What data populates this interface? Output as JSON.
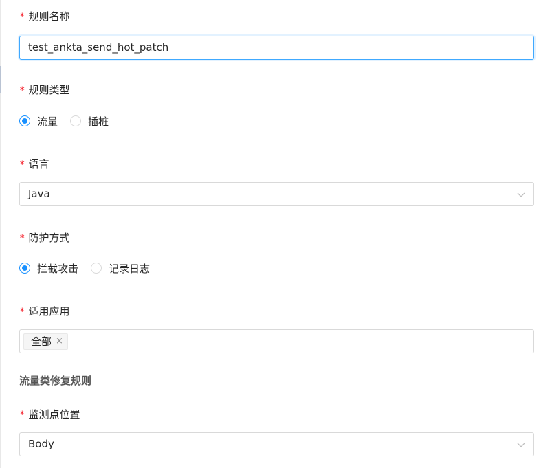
{
  "form": {
    "rule_name": {
      "required_mark": "*",
      "label": "规则名称",
      "value": "test_ankta_send_hot_patch"
    },
    "rule_type": {
      "required_mark": "*",
      "label": "规则类型",
      "options": [
        "流量",
        "插桩"
      ],
      "selected": "流量"
    },
    "language": {
      "required_mark": "*",
      "label": "语言",
      "value": "Java",
      "icon": "chevron-down-icon"
    },
    "protection_mode": {
      "required_mark": "*",
      "label": "防护方式",
      "options": [
        "拦截攻击",
        "记录日志"
      ],
      "selected": "拦截攻击"
    },
    "applicable_apps": {
      "required_mark": "*",
      "label": "适用应用",
      "tags": [
        {
          "label": "全部",
          "close": "×"
        }
      ]
    },
    "traffic_section": {
      "title": "流量类修复规则"
    },
    "monitor_position": {
      "required_mark": "*",
      "label": "监测点位置",
      "value": "Body",
      "icon": "chevron-down-icon"
    }
  },
  "colors": {
    "primary": "#1890ff",
    "required": "#f5222d",
    "border": "#d9d9d9",
    "focus_border": "#40a9ff"
  }
}
